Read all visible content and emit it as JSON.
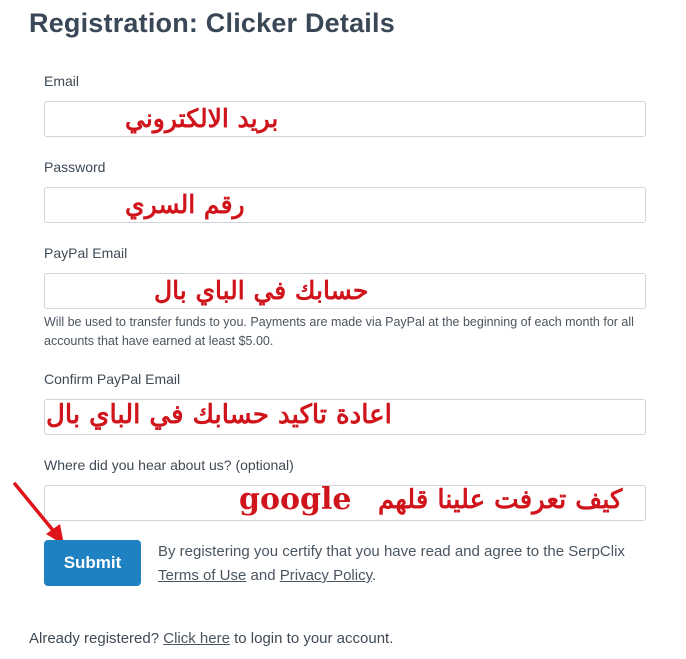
{
  "page": {
    "title": "Registration: Clicker Details"
  },
  "form": {
    "email": {
      "label": "Email",
      "annotation": "بريد الالكتروني"
    },
    "password": {
      "label": "Password",
      "annotation": "رقم السري"
    },
    "paypal_email": {
      "label": "PayPal Email",
      "annotation": "حسابك في الباي بال",
      "help": "Will be used to transfer funds to you. Payments are made via PayPal at the beginning of each month for all accounts that have earned at least $5.00."
    },
    "confirm_paypal_email": {
      "label": "Confirm PayPal Email",
      "annotation": "اعادة تاكيد حسابك في الباي بال"
    },
    "referral": {
      "label": "Where did you hear about us? (optional)",
      "annotation": "كيف تعرفت علينا قلهم",
      "annotation_latin": "google"
    },
    "submit_label": "Submit",
    "terms": {
      "prefix": "By registering you certify that you have read and agree to the SerpClix",
      "terms_link": "Terms of Use",
      "and": "and",
      "privacy_link": "Privacy Policy",
      "suffix": "."
    }
  },
  "footer": {
    "prefix": "Already registered?",
    "link": "Click here",
    "suffix": "to login to your account."
  },
  "colors": {
    "annotation": "#d0141b",
    "button": "#1e81c2",
    "title": "#3a4756"
  },
  "icons": {
    "pointer": "red-arrow-icon"
  }
}
